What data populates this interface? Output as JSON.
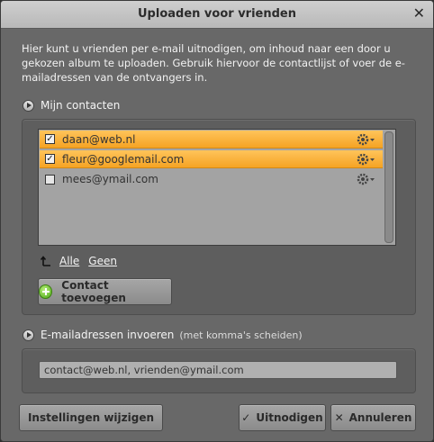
{
  "dialog": {
    "title": "Uploaden voor vrienden",
    "close_icon": "close-icon",
    "intro": "Hier kunt u vrienden per e-mail uitnodigen, om inhoud naar een door u gekozen album te uploaden. Gebruik hiervoor de contactlijst of voer de e-mailadressen van de ontvangers in."
  },
  "contacts": {
    "heading": "Mijn contacten",
    "items": [
      {
        "email": "daan@web.nl",
        "checked": true,
        "selected": true
      },
      {
        "email": "fleur@googlemail.com",
        "checked": true,
        "selected": true
      },
      {
        "email": "mees@ymail.com",
        "checked": false,
        "selected": false
      }
    ],
    "select_all": "Alle",
    "select_none": "Geen",
    "add_contact": "Contact toevoegen"
  },
  "emails": {
    "heading": "E-mailadressen invoeren",
    "hint": "(met komma's scheiden)",
    "value": "contact@web.nl, vrienden@ymail.com"
  },
  "footer": {
    "settings": "Instellingen wijzigen",
    "invite": "Uitnodigen",
    "cancel": "Annuleren"
  },
  "colors": {
    "selected_row": "#f5a324",
    "dialog_bg": "#686868",
    "titlebar": "#c4c4c4"
  }
}
